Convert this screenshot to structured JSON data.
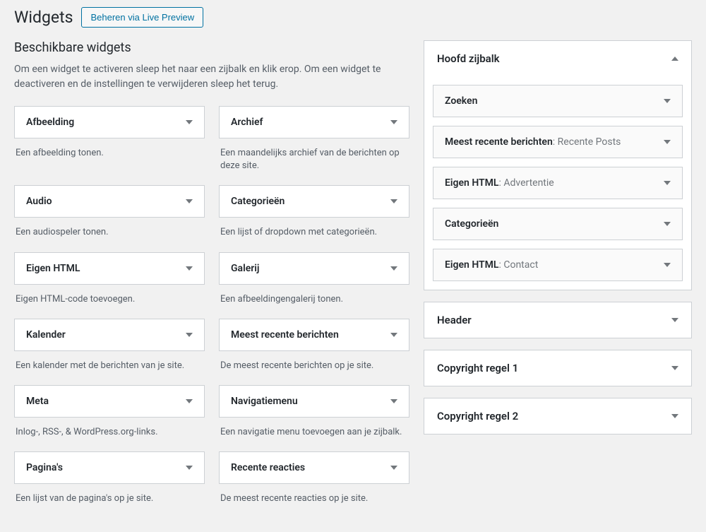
{
  "page": {
    "title": "Widgets",
    "live_preview_btn": "Beheren via Live Preview"
  },
  "available": {
    "heading": "Beschikbare widgets",
    "intro": "Om een widget te activeren sleep het naar een zijbalk en klik erop. Om een widget te deactiveren en de instellingen te verwijderen sleep het terug.",
    "items": [
      {
        "title": "Afbeelding",
        "desc": "Een afbeelding tonen."
      },
      {
        "title": "Archief",
        "desc": "Een maandelijks archief van de berichten op deze site."
      },
      {
        "title": "Audio",
        "desc": "Een audiospeler tonen."
      },
      {
        "title": "Categorieën",
        "desc": "Een lijst of dropdown met categorieën."
      },
      {
        "title": "Eigen HTML",
        "desc": "Eigen HTML-code toevoegen."
      },
      {
        "title": "Galerij",
        "desc": "Een afbeeldingengalerij tonen."
      },
      {
        "title": "Kalender",
        "desc": "Een kalender met de berichten van je site."
      },
      {
        "title": "Meest recente berichten",
        "desc": "De meest recente berichten op je site."
      },
      {
        "title": "Meta",
        "desc": "Inlog-, RSS-, & WordPress.org-links."
      },
      {
        "title": "Navigatiemenu",
        "desc": "Een navigatie menu toevoegen aan je zijbalk."
      },
      {
        "title": "Pagina's",
        "desc": "Een lijst van de pagina's op je site."
      },
      {
        "title": "Recente reacties",
        "desc": "De meest recente reacties op je site."
      }
    ]
  },
  "sidebars": {
    "main": {
      "title": "Hoofd zijbalk",
      "widgets": [
        {
          "name": "Zoeken",
          "sub": ""
        },
        {
          "name": "Meest recente berichten",
          "sub": "Recente Posts"
        },
        {
          "name": "Eigen HTML",
          "sub": "Advertentie"
        },
        {
          "name": "Categorieën",
          "sub": ""
        },
        {
          "name": "Eigen HTML",
          "sub": "Contact"
        }
      ]
    },
    "collapsed": [
      {
        "title": "Header"
      },
      {
        "title": "Copyright regel 1"
      },
      {
        "title": "Copyright regel 2"
      }
    ]
  }
}
